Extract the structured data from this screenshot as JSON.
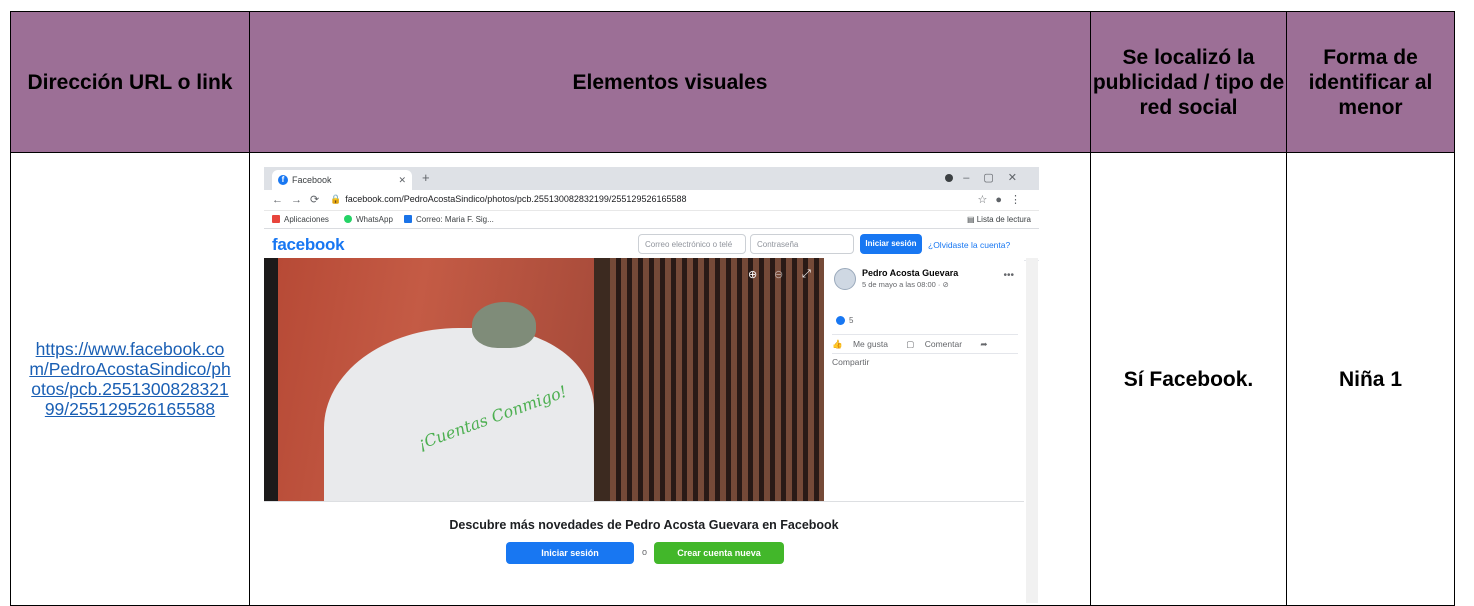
{
  "headers": {
    "col1": "Dirección URL o link",
    "col2": "Elementos visuales",
    "col3": "Se localizó la publicidad / tipo de red social",
    "col4": "Forma de identificar al menor"
  },
  "row": {
    "url": "https://www.facebook.com/PedroAcostaSindico/photos/pcb.255130082832199/255129526165588",
    "found": "Sí Facebook.",
    "identifier": "Niña 1"
  },
  "screenshot": {
    "tab_title": "Facebook",
    "address": "facebook.com/PedroAcostaSindico/photos/pcb.255130082832199/255129526165588",
    "bookmarks": [
      "Aplicaciones",
      "WhatsApp",
      "Correo: Maria F. Sig..."
    ],
    "reading_list": "Lista de lectura",
    "fb_logo": "facebook",
    "email_placeholder": "Correo electrónico o telé",
    "password_placeholder": "Contraseña",
    "login_label": "Iniciar sesión",
    "forgot_label": "¿Olvidaste la cuenta?",
    "photo_text": "¡Cuentas Conmigo!",
    "author": "Pedro Acosta Guevara",
    "post_date": "5 de mayo a las 08:00 · ⊘",
    "likes": "5",
    "actions": [
      "Me gusta",
      "Comentar",
      "Compartir"
    ],
    "discover": "Descubre más novedades de Pedro Acosta Guevara en Facebook",
    "or": "o",
    "create_account": "Crear cuenta nueva",
    "colors": {
      "header_bg": "#9c6f96",
      "fb_blue": "#1877f2",
      "fb_green": "#42b72a"
    }
  }
}
